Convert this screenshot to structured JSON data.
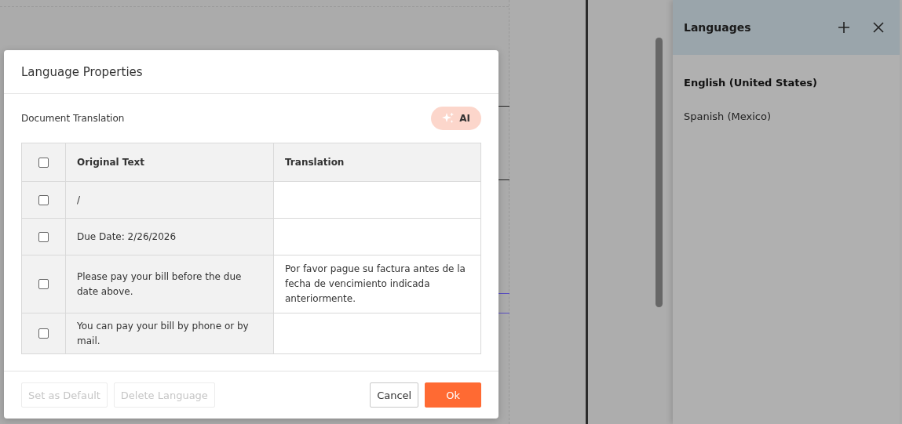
{
  "dialog": {
    "title": "Language Properties",
    "section_title": "Document Translation",
    "ai_button": {
      "label": "AI",
      "disabled": true
    },
    "table": {
      "columns": [
        "Original Text",
        "Translation"
      ],
      "header_checked": false,
      "rows": [
        {
          "checked": false,
          "original": "/",
          "translation": ""
        },
        {
          "checked": false,
          "original": "Due Date: 2/26/2026",
          "translation": ""
        },
        {
          "checked": false,
          "original": "Please pay your bill before the due date above.",
          "translation": "Por favor pague su factura antes de la fecha de vencimiento indicada anteriormente."
        },
        {
          "checked": false,
          "original": "You can pay your bill by phone or by mail.",
          "translation": ""
        }
      ]
    },
    "footer_buttons": [
      {
        "label": "Set as Default",
        "kind": "plain",
        "disabled": true
      },
      {
        "label": "Delete Language",
        "kind": "plain",
        "disabled": true
      },
      {
        "label": "Cancel",
        "kind": "outline",
        "disabled": false
      },
      {
        "label": "Ok",
        "kind": "primary",
        "disabled": false
      }
    ]
  },
  "languages_panel": {
    "title": "Languages",
    "items": [
      {
        "label": "English (United States)",
        "selected": true
      },
      {
        "label": "Spanish (Mexico)",
        "selected": false
      }
    ]
  }
}
